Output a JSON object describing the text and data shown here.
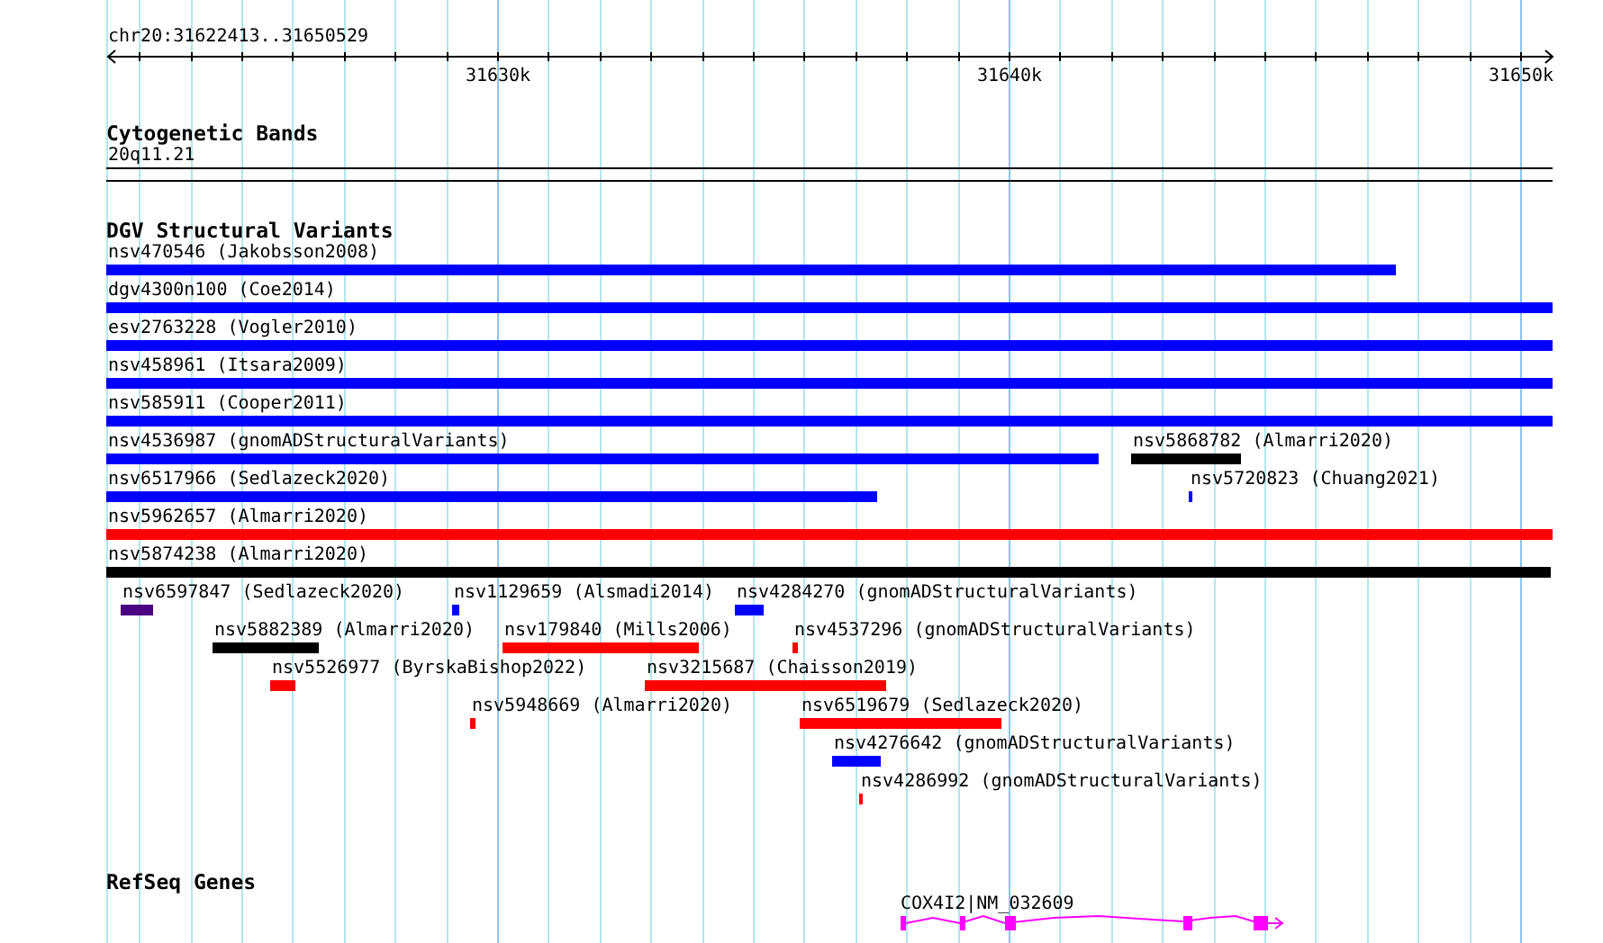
{
  "location": "chr20:31622413..31650529",
  "ruler": {
    "tick_labels": [
      "31630k",
      "31640k",
      "31650k"
    ]
  },
  "tracks": [
    {
      "kind": "cytoband",
      "title": "Cytogenetic Bands",
      "band": "20q11.21"
    },
    {
      "kind": "variants",
      "title": "DGV Structural Variants",
      "features": [
        {
          "label": "nsv470546 (Jakobsson2008)",
          "color": "#0000ff"
        },
        {
          "label": "dgv4300n100 (Coe2014)",
          "color": "#0000ff"
        },
        {
          "label": "esv2763228 (Vogler2010)",
          "color": "#0000ff"
        },
        {
          "label": "nsv458961 (Itsara2009)",
          "color": "#0000ff"
        },
        {
          "label": "nsv585911 (Cooper2011)",
          "color": "#0000ff"
        },
        {
          "label": "nsv4536987 (gnomADStructuralVariants)",
          "color": "#0000ff"
        },
        {
          "label": "nsv5868782 (Almarri2020)",
          "color": "#000000"
        },
        {
          "label": "nsv6517966 (Sedlazeck2020)",
          "color": "#0000ff"
        },
        {
          "label": "nsv5720823 (Chuang2021)",
          "color": "#0000ff"
        },
        {
          "label": "nsv5962657 (Almarri2020)",
          "color": "#ff0000"
        },
        {
          "label": "nsv5874238 (Almarri2020)",
          "color": "#000000"
        },
        {
          "label": "nsv6597847 (Sedlazeck2020)",
          "color": "#4b0082"
        },
        {
          "label": "nsv1129659 (Alsmadi2014)",
          "color": "#0000ff"
        },
        {
          "label": "nsv4284270 (gnomADStructuralVariants)",
          "color": "#0000ff"
        },
        {
          "label": "nsv5882389 (Almarri2020)",
          "color": "#000000"
        },
        {
          "label": "nsv179840 (Mills2006)",
          "color": "#ff0000"
        },
        {
          "label": "nsv4537296 (gnomADStructuralVariants)",
          "color": "#ff0000"
        },
        {
          "label": "nsv5526977 (ByrskaBishop2022)",
          "color": "#ff0000"
        },
        {
          "label": "nsv3215687 (Chaisson2019)",
          "color": "#ff0000"
        },
        {
          "label": "nsv5948669 (Almarri2020)",
          "color": "#ff0000"
        },
        {
          "label": "nsv6519679 (Sedlazeck2020)",
          "color": "#ff0000"
        },
        {
          "label": "nsv4276642 (gnomADStructuralVariants)",
          "color": "#0000ff"
        },
        {
          "label": "nsv4286992 (gnomADStructuralVariants)",
          "color": "#ff0000"
        }
      ]
    },
    {
      "kind": "genes",
      "title": "RefSeq Genes",
      "genes": [
        {
          "label": "COX4I2|NM_032609"
        }
      ]
    }
  ]
}
